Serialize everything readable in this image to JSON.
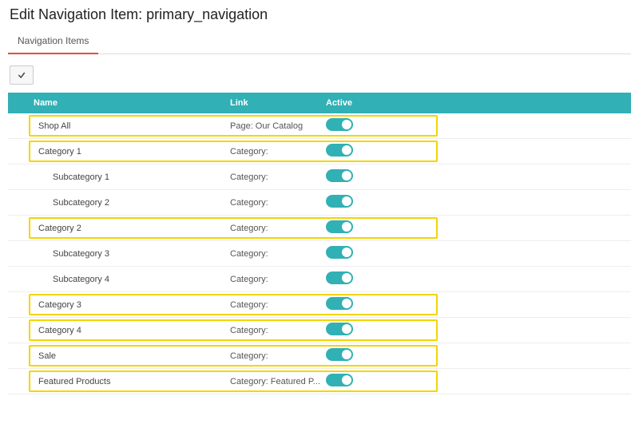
{
  "page_title": "Edit Navigation Item: primary_navigation",
  "tabs": [
    {
      "label": "Navigation Items",
      "active": true
    }
  ],
  "table": {
    "headers": {
      "name": "Name",
      "link": "Link",
      "active": "Active"
    },
    "rows": [
      {
        "name": "Shop All",
        "link": "Page: Our Catalog",
        "active": true,
        "indent": false,
        "highlight": true
      },
      {
        "name": "Category 1",
        "link": "Category:",
        "active": true,
        "indent": false,
        "highlight": true
      },
      {
        "name": "Subcategory 1",
        "link": "Category:",
        "active": true,
        "indent": true,
        "highlight": false
      },
      {
        "name": "Subcategory 2",
        "link": "Category:",
        "active": true,
        "indent": true,
        "highlight": false
      },
      {
        "name": "Category 2",
        "link": "Category:",
        "active": true,
        "indent": false,
        "highlight": true
      },
      {
        "name": "Subcategory 3",
        "link": "Category:",
        "active": true,
        "indent": true,
        "highlight": false
      },
      {
        "name": "Subcategory 4",
        "link": "Category:",
        "active": true,
        "indent": true,
        "highlight": false
      },
      {
        "name": "Category 3",
        "link": "Category:",
        "active": true,
        "indent": false,
        "highlight": true
      },
      {
        "name": "Category 4",
        "link": "Category:",
        "active": true,
        "indent": false,
        "highlight": true
      },
      {
        "name": "Sale",
        "link": "Category:",
        "active": true,
        "indent": false,
        "highlight": true
      },
      {
        "name": "Featured Products",
        "link": "Category: Featured P...",
        "active": true,
        "indent": false,
        "highlight": true
      }
    ]
  }
}
